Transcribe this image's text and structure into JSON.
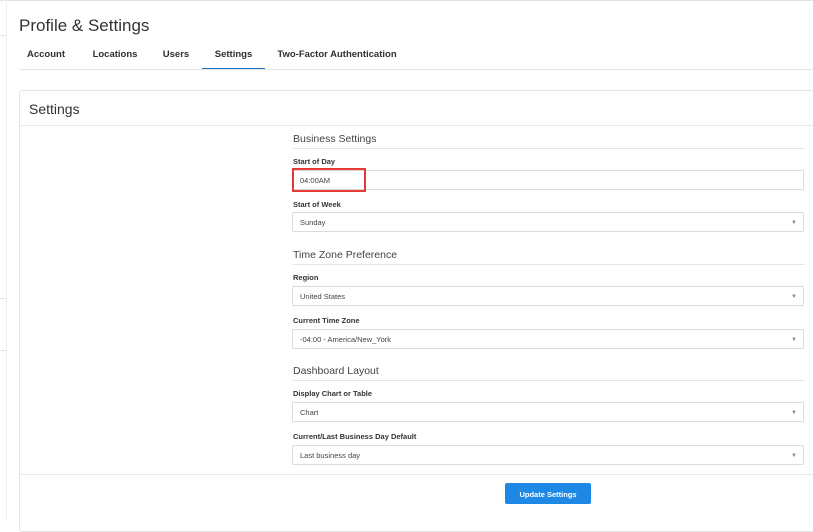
{
  "page": {
    "title": "Profile & Settings"
  },
  "tabs": [
    {
      "label": "Account"
    },
    {
      "label": "Locations"
    },
    {
      "label": "Users"
    },
    {
      "label": "Settings",
      "active": true
    },
    {
      "label": "Two-Factor Authentication"
    }
  ],
  "card": {
    "title": "Settings"
  },
  "business": {
    "section_title": "Business Settings",
    "start_of_day_label": "Start of Day",
    "start_of_day_value": "04:00AM",
    "start_of_week_label": "Start of Week",
    "start_of_week_value": "Sunday"
  },
  "timezone": {
    "section_title": "Time Zone Preference",
    "region_label": "Region",
    "region_value": "United States",
    "current_tz_label": "Current Time Zone",
    "current_tz_value": "-04:00 - America/New_York"
  },
  "dashboard": {
    "section_title": "Dashboard Layout",
    "display_label": "Display Chart or Table",
    "display_value": "Chart",
    "business_day_label": "Current/Last Business Day Default",
    "business_day_value": "Last business day"
  },
  "actions": {
    "update_label": "Update Settings"
  },
  "colors": {
    "accent": "#1e88e5",
    "active_tab_underline": "#1f6fc5",
    "highlight_box": "#e53935"
  },
  "icons": {
    "dropdown": "chevron-down-icon"
  }
}
